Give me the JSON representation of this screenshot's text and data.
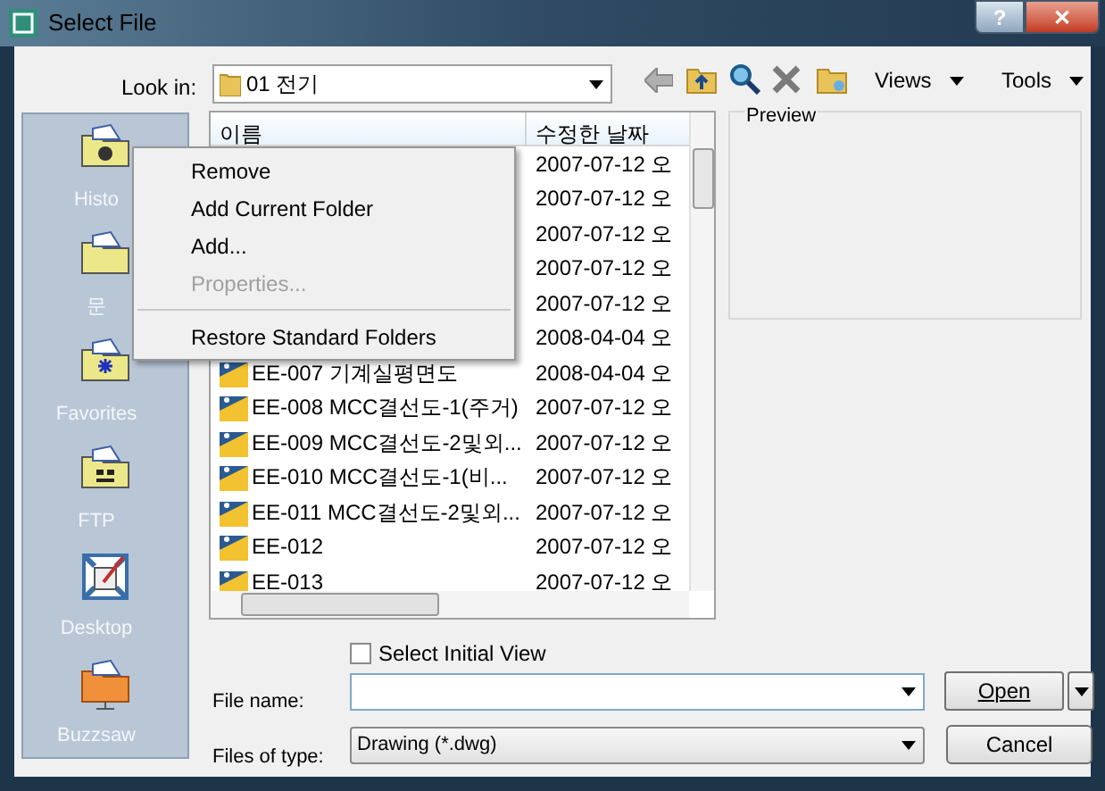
{
  "window": {
    "title": "Select File",
    "help_button": "?",
    "close_button": "✕"
  },
  "toolbar": {
    "look_in_label": "Look in:",
    "look_in_value": "01 전기",
    "views": "Views",
    "tools": "Tools"
  },
  "places": [
    {
      "label": "Histo"
    },
    {
      "label": "문"
    },
    {
      "label": "Favorites"
    },
    {
      "label": "FTP"
    },
    {
      "label": "Desktop"
    },
    {
      "label": "Buzzsaw"
    }
  ],
  "file_list": {
    "columns": [
      "이름",
      "수정한 날짜"
    ],
    "rows": [
      {
        "date": "2007-07-12 오"
      },
      {
        "date": "2007-07-12 오"
      },
      {
        "date": "2007-07-12 오"
      },
      {
        "date": "2007-07-12 오"
      },
      {
        "date": "2007-07-12 오"
      },
      {
        "date": "2008-04-04 오"
      },
      {
        "name": "EE-007 기계실평면도",
        "date": "2008-04-04 오"
      },
      {
        "name": "EE-008 MCC결선도-1(주거)",
        "date": "2007-07-12 오"
      },
      {
        "name": "EE-009 MCC결선도-2및외...",
        "date": "2007-07-12 오"
      },
      {
        "name": "EE-010 MCC결선도-1(비...",
        "date": "2007-07-12 오"
      },
      {
        "name": "EE-011 MCC결선도-2및외...",
        "date": "2007-07-12 오"
      },
      {
        "name": "EE-012",
        "date": "2007-07-12 오"
      },
      {
        "name": "EE-013",
        "date": "2007-07-12 오"
      }
    ]
  },
  "preview": {
    "label": "Preview"
  },
  "context_menu": [
    {
      "label": "Remove",
      "disabled": false
    },
    {
      "label": "Add Current Folder",
      "disabled": false
    },
    {
      "label": "Add...",
      "disabled": false
    },
    {
      "label": "Properties...",
      "disabled": true
    },
    {
      "kind": "separator"
    },
    {
      "label": "Restore Standard Folders",
      "disabled": false
    }
  ],
  "select_initial_view": {
    "label": "Select Initial View",
    "checked": false
  },
  "file_name": {
    "label": "File name:"
  },
  "files_of_type": {
    "label": "Files of type:",
    "value": "Drawing (*.dwg)"
  },
  "buttons": {
    "open": "Open",
    "cancel": "Cancel"
  }
}
